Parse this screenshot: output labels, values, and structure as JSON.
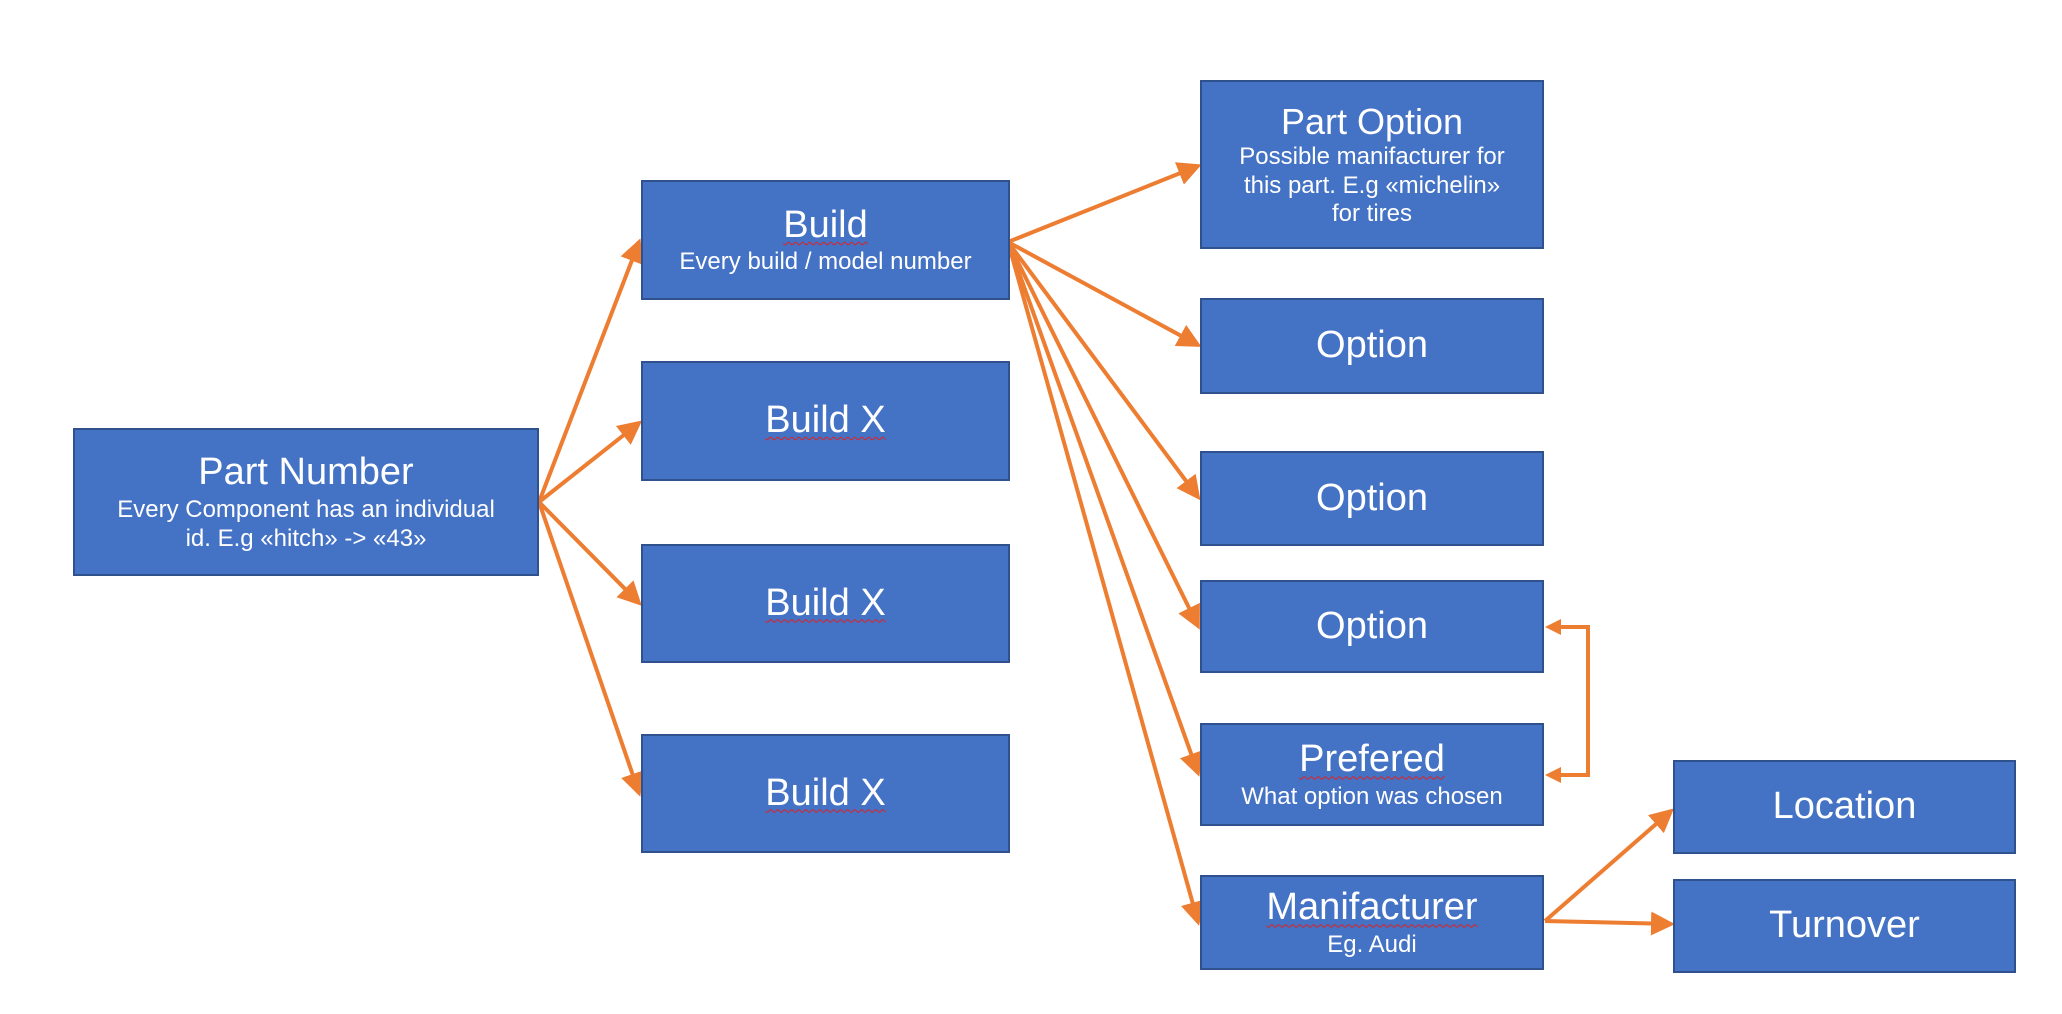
{
  "colors": {
    "node_fill": "#4472C4",
    "node_border": "#2F528F",
    "arrow": "#ED7D31",
    "text": "#FFFFFF"
  },
  "nodes": {
    "part_number": {
      "title": "Part Number",
      "subtitle_line1": "Every Component has an individual",
      "subtitle_line2": "id. E.g «hitch» -> «43»"
    },
    "build": {
      "title": "Build",
      "subtitle": "Every build / model number"
    },
    "build_x1": {
      "title": "Build X"
    },
    "build_x2": {
      "title": "Build X"
    },
    "build_x3": {
      "title": "Build X"
    },
    "part_option": {
      "title": "Part Option",
      "subtitle_line1": "Possible manifacturer for",
      "subtitle_line2": "this part. E.g «michelin»",
      "subtitle_line3": "for tires"
    },
    "option1": {
      "title": "Option"
    },
    "option2": {
      "title": "Option"
    },
    "option3": {
      "title": "Option"
    },
    "prefered": {
      "title": "Prefered",
      "subtitle": "What option was chosen"
    },
    "manifacturer": {
      "title": "Manifacturer",
      "subtitle": "Eg. Audi"
    },
    "location": {
      "title": "Location"
    },
    "turnover": {
      "title": "Turnover"
    }
  },
  "edges": [
    {
      "from": "part_number",
      "to": "build"
    },
    {
      "from": "part_number",
      "to": "build_x1"
    },
    {
      "from": "part_number",
      "to": "build_x2"
    },
    {
      "from": "part_number",
      "to": "build_x3"
    },
    {
      "from": "build",
      "to": "part_option"
    },
    {
      "from": "build",
      "to": "option1"
    },
    {
      "from": "build",
      "to": "option2"
    },
    {
      "from": "build",
      "to": "option3"
    },
    {
      "from": "build",
      "to": "prefered"
    },
    {
      "from": "build",
      "to": "manifacturer"
    },
    {
      "from": "manifacturer",
      "to": "location"
    },
    {
      "from": "manifacturer",
      "to": "turnover"
    },
    {
      "from": "option3",
      "to": "prefered",
      "style": "bracket-bidirectional"
    }
  ]
}
